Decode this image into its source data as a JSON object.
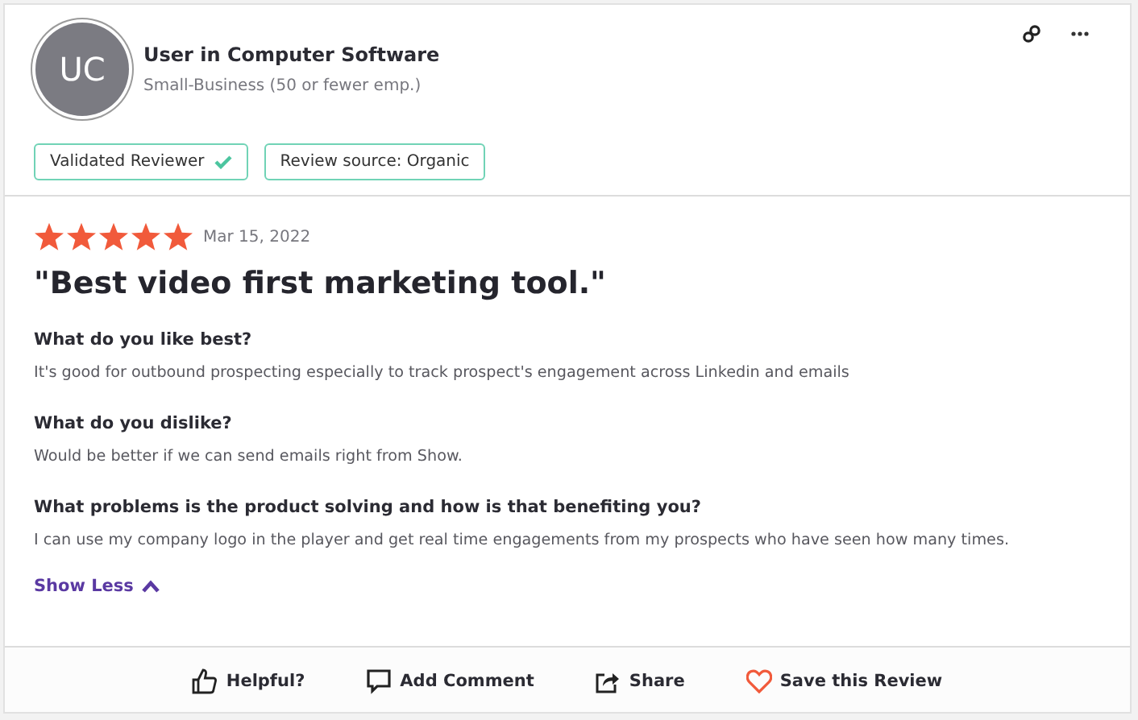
{
  "reviewer": {
    "initials": "UC",
    "name": "User in Computer Software",
    "segment": "Small-Business (50 or fewer emp.)"
  },
  "badges": [
    {
      "label": "Validated Reviewer",
      "kind": "verified"
    },
    {
      "label": "Review source: Organic",
      "kind": "plain"
    }
  ],
  "review": {
    "stars": 5,
    "date": "Mar 15, 2022",
    "title": "\"Best video first marketing tool.\"",
    "sections": [
      {
        "question": "What do you like best?",
        "answer": "It's good for outbound prospecting especially to track prospect's engagement across Linkedin and emails"
      },
      {
        "question": "What do you dislike?",
        "answer": "Would be better if we can send emails right from Show."
      },
      {
        "question": "What problems is the product solving and how is that benefiting you?",
        "answer": "I can use my company logo in the player and get real time engagements from my prospects who have seen how many times."
      }
    ],
    "toggle": "Show Less"
  },
  "actions": [
    {
      "label": "Helpful?",
      "kind": "helpful"
    },
    {
      "label": "Add Comment",
      "kind": "comment"
    },
    {
      "label": "Share",
      "kind": "share"
    },
    {
      "label": "Save this Review",
      "kind": "save"
    }
  ]
}
